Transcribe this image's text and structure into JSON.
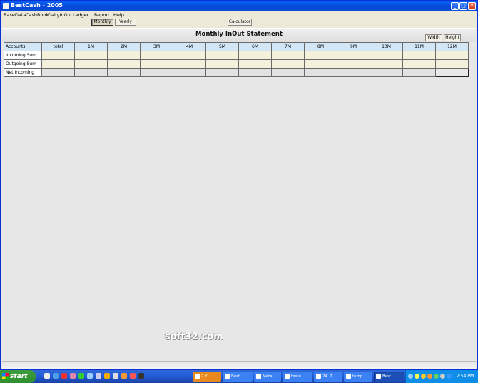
{
  "window": {
    "title": "BestCash - 2005"
  },
  "menu": [
    "BaseData",
    "CashBook",
    "DailyInOut",
    "Ledger",
    "Report",
    "Help"
  ],
  "toolbar": {
    "monthly": "Monthly",
    "yearly": "Yearly",
    "calculator": "Calculator"
  },
  "report": {
    "title": "Monthly InOut Statement",
    "width_btn": "Width",
    "height_btn": "Height"
  },
  "table": {
    "headers": [
      "Accounts",
      "total",
      "1M",
      "2M",
      "3M",
      "4M",
      "5M",
      "6M",
      "7M",
      "8M",
      "9M",
      "10M",
      "11M",
      "12M"
    ],
    "rows": [
      "Incoming Sum",
      "Outgoing Sum",
      "Net Incoming"
    ]
  },
  "watermark": "soft32.com",
  "taskbar": {
    "start": "start",
    "tasks": [
      "2 Y...",
      "Best ...",
      "Meta...",
      "teste",
      "24. T...",
      "temp...",
      "Best..."
    ],
    "clock": "2:54 PM"
  }
}
